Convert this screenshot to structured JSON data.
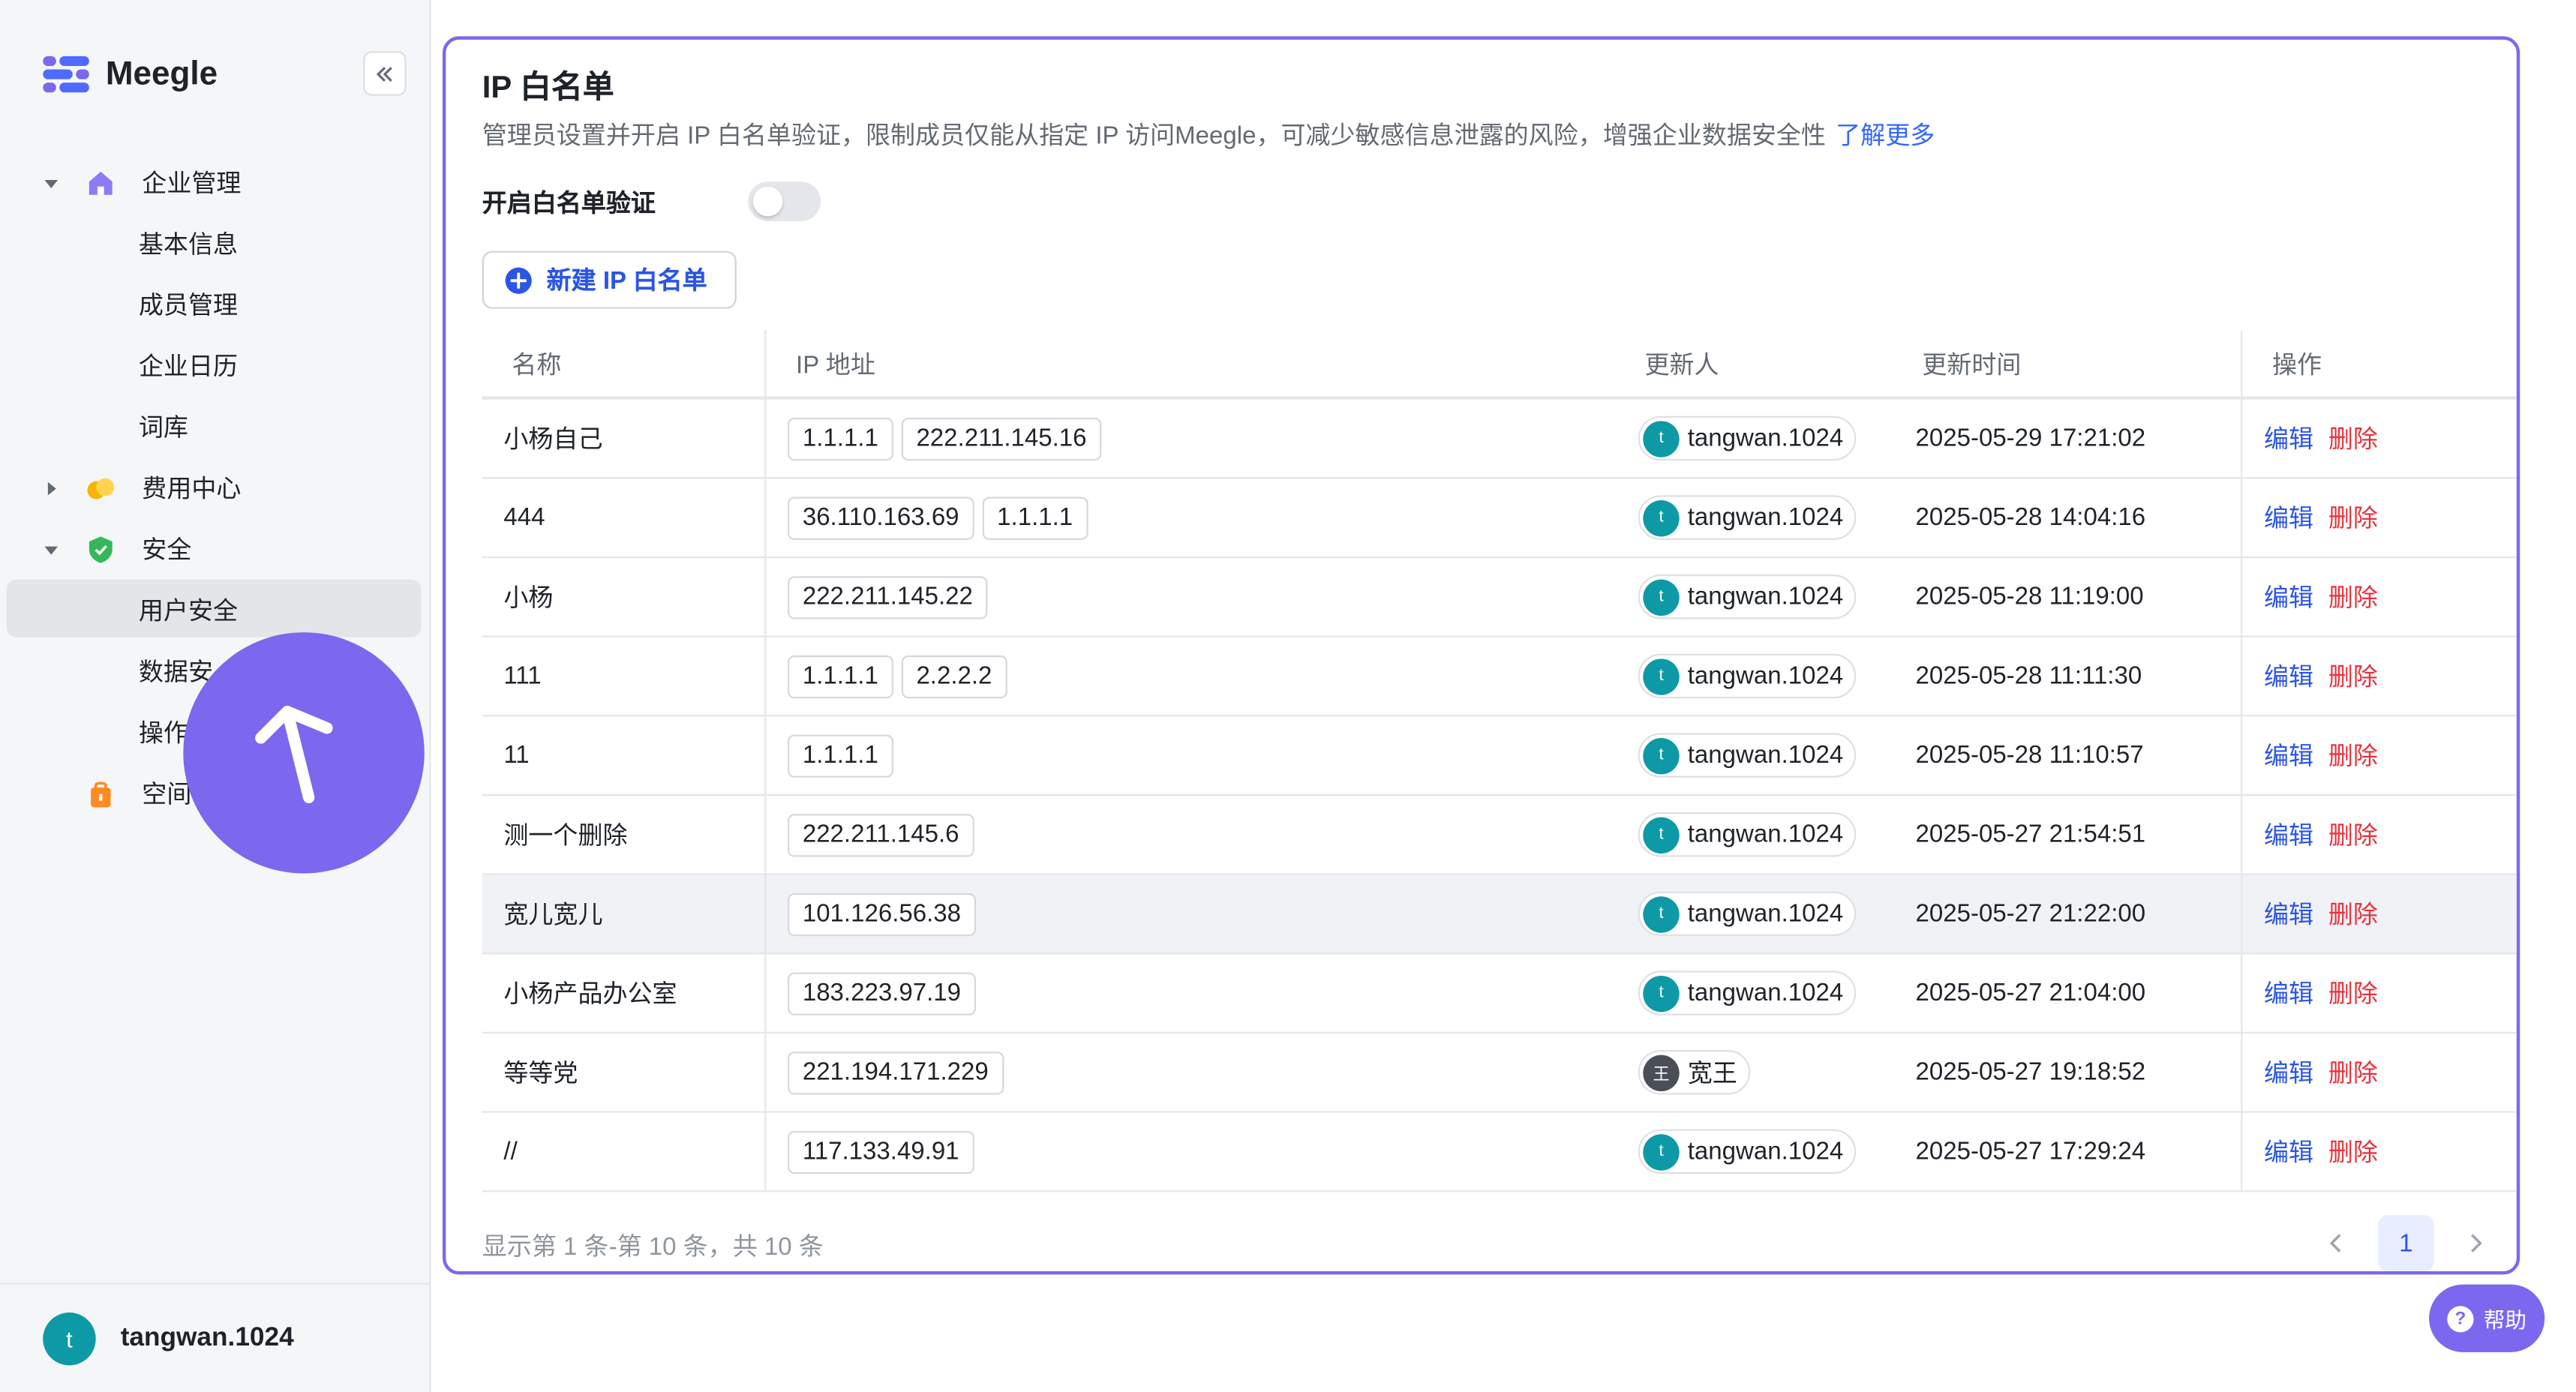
{
  "brand": {
    "name": "Meegle"
  },
  "sidebar": {
    "groups": [
      {
        "label": "企业管理",
        "expanded": true,
        "icon": "home-icon",
        "color": "#8b7cf6",
        "items": [
          "基本信息",
          "成员管理",
          "企业日历",
          "词库"
        ]
      },
      {
        "label": "费用中心",
        "expanded": false,
        "icon": "coins-icon",
        "color": "#f7b500",
        "items": []
      },
      {
        "label": "安全",
        "expanded": true,
        "icon": "shield-icon",
        "color": "#34b85a",
        "items": [
          "用户安全",
          "数据安",
          "操作"
        ]
      },
      {
        "label": "空间",
        "expanded": false,
        "icon": "bag-icon",
        "color": "#ff8a1f",
        "items": []
      }
    ],
    "active_item": "用户安全",
    "user": {
      "initial": "t",
      "name": "tangwan.1024"
    }
  },
  "main": {
    "title": "IP 白名单",
    "description": "管理员设置并开启 IP 白名单验证，限制成员仅能从指定 IP 访问Meegle，可减少敏感信息泄露的风险，增强企业数据安全性",
    "learn_more": "了解更多",
    "toggle_label": "开启白名单验证",
    "toggle_on": false,
    "new_button": "新建 IP 白名单",
    "table": {
      "columns": [
        "名称",
        "IP 地址",
        "更新人",
        "更新时间",
        "操作"
      ],
      "rows": [
        {
          "name": "小杨自己",
          "ips": [
            "1.1.1.1",
            "222.211.145.16"
          ],
          "updater_initial": "t",
          "updater": "tangwan.1024",
          "time": "2025-05-29 17:21:02"
        },
        {
          "name": "444",
          "ips": [
            "36.110.163.69",
            "1.1.1.1"
          ],
          "updater_initial": "t",
          "updater": "tangwan.1024",
          "time": "2025-05-28 14:04:16"
        },
        {
          "name": "小杨",
          "ips": [
            "222.211.145.22"
          ],
          "updater_initial": "t",
          "updater": "tangwan.1024",
          "time": "2025-05-28 11:19:00"
        },
        {
          "name": "111",
          "ips": [
            "1.1.1.1",
            "2.2.2.2"
          ],
          "updater_initial": "t",
          "updater": "tangwan.1024",
          "time": "2025-05-28 11:11:30"
        },
        {
          "name": "11",
          "ips": [
            "1.1.1.1"
          ],
          "updater_initial": "t",
          "updater": "tangwan.1024",
          "time": "2025-05-28 11:10:57"
        },
        {
          "name": "测一个删除",
          "ips": [
            "222.211.145.6"
          ],
          "updater_initial": "t",
          "updater": "tangwan.1024",
          "time": "2025-05-27 21:54:51"
        },
        {
          "name": "宽儿宽儿",
          "ips": [
            "101.126.56.38"
          ],
          "updater_initial": "t",
          "updater": "tangwan.1024",
          "time": "2025-05-27 21:22:00",
          "highlighted": true
        },
        {
          "name": "小杨产品办公室",
          "ips": [
            "183.223.97.19"
          ],
          "updater_initial": "t",
          "updater": "tangwan.1024",
          "time": "2025-05-27 21:04:00"
        },
        {
          "name": "等等党",
          "ips": [
            "221.194.171.229"
          ],
          "updater_initial": "王",
          "updater": "宽王",
          "time": "2025-05-27 19:18:52",
          "dark_avatar": true
        },
        {
          "name": "//",
          "ips": [
            "117.133.49.91"
          ],
          "updater_initial": "t",
          "updater": "tangwan.1024",
          "time": "2025-05-27 17:29:24"
        }
      ],
      "edit_label": "编辑",
      "delete_label": "删除"
    },
    "pagination": {
      "summary": "显示第 1 条-第 10 条，共 10 条",
      "current_page": "1"
    }
  },
  "help": {
    "label": "帮助"
  },
  "colors": {
    "accent": "#7b68ee",
    "link": "#3366ff",
    "danger": "#e8323c",
    "avatar": "#0d9aa6"
  }
}
